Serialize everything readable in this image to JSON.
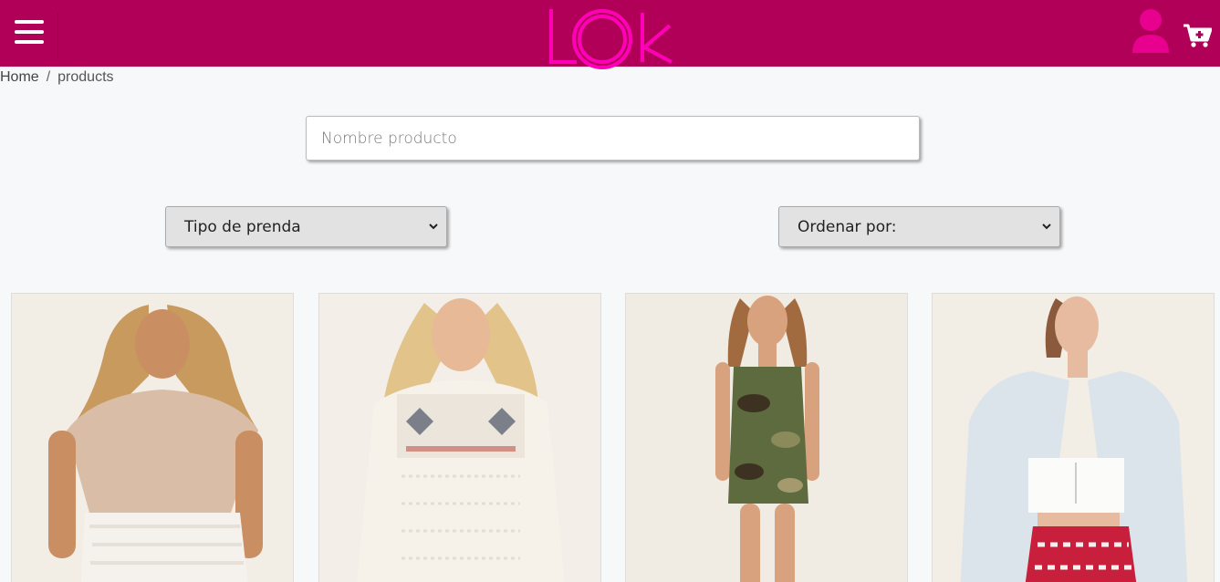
{
  "header": {
    "logo_text": "LOk",
    "colors": {
      "bar": "#b10058",
      "logo": "#ff00b8",
      "user_icon": "#e8008f"
    },
    "icons": {
      "menu": "hamburger-menu-icon",
      "user": "user-icon",
      "cart": "cart-plus-icon"
    }
  },
  "breadcrumb": {
    "home": "Home",
    "separator": "/",
    "current": "products"
  },
  "search": {
    "placeholder": "Nombre producto",
    "value": ""
  },
  "filters": {
    "type": {
      "selected": "Tipo de prenda"
    },
    "order": {
      "selected": "Ordenar por:"
    }
  },
  "products": [
    {
      "description": "woman in beige short-sleeve top and white lace skirt"
    },
    {
      "description": "woman in white embroidered lace peasant blouse"
    },
    {
      "description": "woman in camouflage bodycon mini dress"
    },
    {
      "description": "woman in denim jacket, white lace-up crop top and red patterned shorts"
    }
  ]
}
